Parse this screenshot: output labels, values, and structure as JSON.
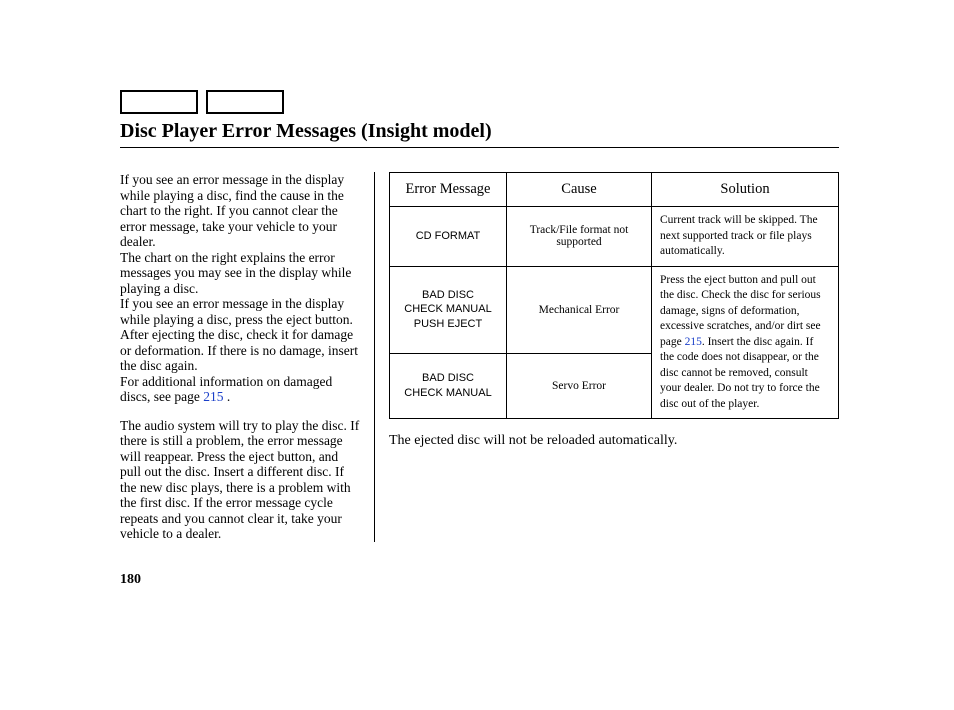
{
  "title": "Disc Player Error Messages (Insight model)",
  "left": {
    "p1": "If you see an error message in the display while playing a disc, find the cause in the chart to the right. If you cannot clear the error message, take your vehicle to your dealer.",
    "p2": "The chart on the right explains the error messages you may see in the display while playing a disc.",
    "p3": "If you see an error message in the display while playing a disc, press the eject button. After ejecting the disc, check it for damage or deformation. If there is no damage, insert the disc again.",
    "p4a": "For additional information on damaged discs, see page ",
    "p4link": "215",
    "p4b": " .",
    "p5": "The audio system will try to play the disc. If there is still a problem, the error message will reappear. Press the eject button, and pull out the disc. Insert a different disc. If the new disc plays, there is a problem with the first disc. If the error message cycle repeats and you cannot clear it, take your vehicle to a dealer."
  },
  "table": {
    "headers": {
      "error": "Error Message",
      "cause": "Cause",
      "solution": "Solution"
    },
    "rows": [
      {
        "error_lines": [
          "CD FORMAT"
        ],
        "cause": "Track/File format not supported",
        "solution": "Current track will be skipped. The next supported track or file plays automatically."
      },
      {
        "error_lines": [
          "BAD DISC",
          "CHECK MANUAL",
          "PUSH EJECT"
        ],
        "cause": "Mechanical Error",
        "solution_a": "Press the eject button and pull out the disc. Check the disc for serious damage, signs of deformation, excessive scratches, and/or dirt see page ",
        "solution_link": "215",
        "solution_b": ". Insert the disc again. If the code does not disappear, or the disc cannot be removed, consult your dealer. Do not try to force the disc out of the player."
      },
      {
        "error_lines": [
          "BAD DISC",
          "CHECK MANUAL"
        ],
        "cause": "Servo Error"
      }
    ]
  },
  "note": "The ejected disc will not be reloaded automatically.",
  "page_number": "180"
}
